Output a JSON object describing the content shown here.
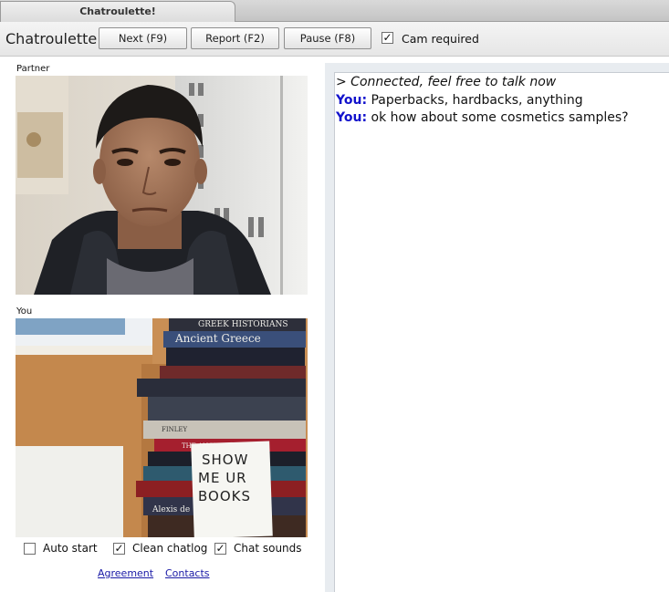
{
  "tab": {
    "title": "Chatroulette!"
  },
  "toolbar": {
    "brand": "Chatroulette",
    "next_label": "Next (F9)",
    "report_label": "Report (F2)",
    "pause_label": "Pause (F8)",
    "cam_required": {
      "label": "Cam required",
      "checked": true
    }
  },
  "partner": {
    "label": "Partner"
  },
  "self": {
    "label": "You",
    "sign_lines": [
      "SHOW",
      "ME UR",
      "BOOKS"
    ],
    "book_titles": [
      "GREEK HISTORIANS",
      "Ancient Greece",
      "THE ANCIENT ECONOMY",
      "FINLEY",
      "Alexis de"
    ]
  },
  "options": {
    "auto_start": {
      "label": "Auto start",
      "checked": false
    },
    "clean_chatlog": {
      "label": "Clean chatlog",
      "checked": true
    },
    "chat_sounds": {
      "label": "Chat sounds",
      "checked": true
    }
  },
  "links": {
    "agreement": "Agreement",
    "contacts": "Contacts"
  },
  "chat": {
    "system_message": "> Connected, feel free to talk now",
    "messages": [
      {
        "speaker": "You:",
        "text": " Paperbacks, hardbacks, anything"
      },
      {
        "speaker": "You:",
        "text": " ok how about some cosmetics samples?"
      }
    ]
  },
  "colors": {
    "speaker": "#1111cc",
    "link": "#1a1aa6"
  }
}
